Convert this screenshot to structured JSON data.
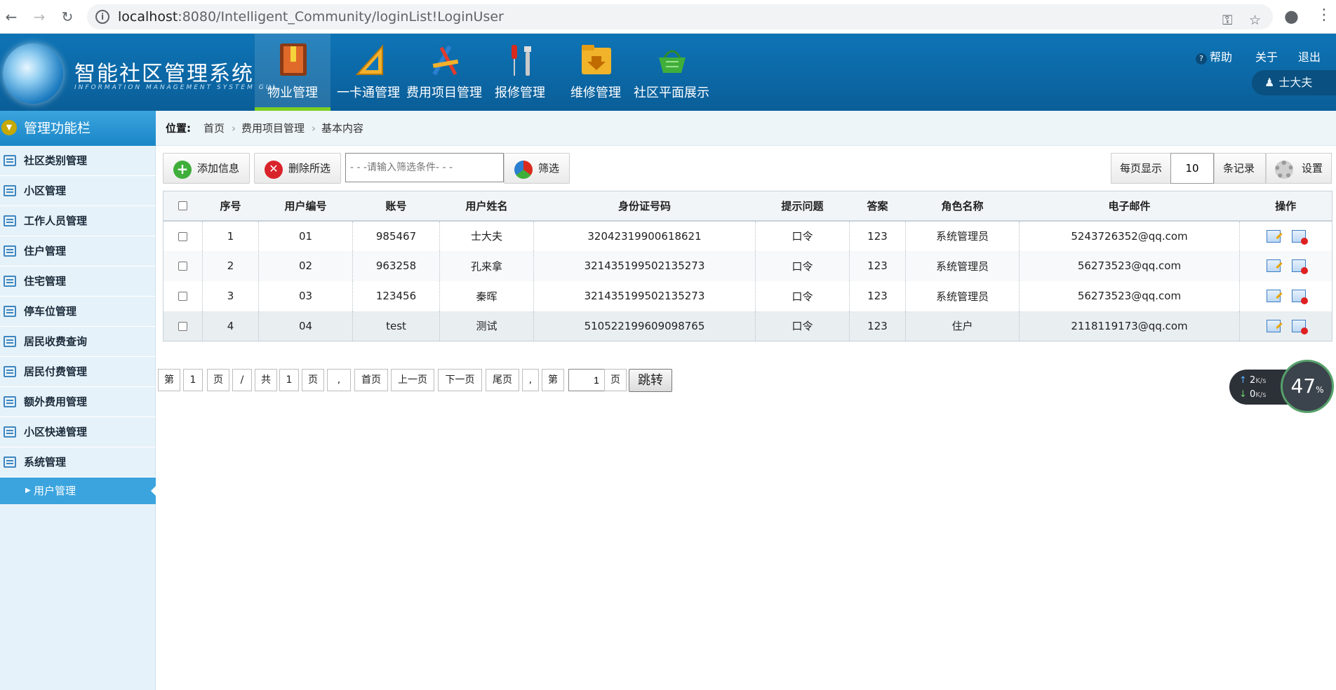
{
  "browser": {
    "url_host": "localhost",
    "url_path": ":8080/Intelligent_Community/loginList!LoginUser"
  },
  "header": {
    "title": "智能社区管理系统",
    "subtitle": "INFORMATION MANAGEMENT SYSTEM GUI",
    "nav": [
      {
        "label": "物业管理",
        "active": true
      },
      {
        "label": "一卡通管理"
      },
      {
        "label": "费用项目管理"
      },
      {
        "label": "报修管理"
      },
      {
        "label": "维修管理"
      },
      {
        "label": "社区平面展示"
      }
    ],
    "links": {
      "help": "帮助",
      "about": "关于",
      "logout": "退出"
    },
    "user": "士大夫"
  },
  "sidebar": {
    "title": "管理功能栏",
    "items": [
      {
        "label": "社区类别管理"
      },
      {
        "label": "小区管理"
      },
      {
        "label": "工作人员管理"
      },
      {
        "label": "住户管理"
      },
      {
        "label": "住宅管理"
      },
      {
        "label": "停车位管理"
      },
      {
        "label": "居民收费查询"
      },
      {
        "label": "居民付费管理"
      },
      {
        "label": "额外费用管理"
      },
      {
        "label": "小区快递管理"
      },
      {
        "label": "系统管理"
      }
    ],
    "sub_active": "用户管理"
  },
  "breadcrumb": {
    "lead": "位置:",
    "items": [
      "首页",
      "费用项目管理",
      "基本内容"
    ]
  },
  "toolbar": {
    "add": "添加信息",
    "delete": "删除所选",
    "filter_placeholder": "- - -请输入筛选条件- - -",
    "filter": "筛选",
    "per_page_label": "每页显示",
    "per_page_value": "10",
    "records_label": "条记录",
    "settings": "设置"
  },
  "table": {
    "headers": [
      "序号",
      "用户编号",
      "账号",
      "用户姓名",
      "身份证号码",
      "提示问题",
      "答案",
      "角色名称",
      "电子邮件",
      "操作"
    ],
    "rows": [
      [
        "1",
        "01",
        "985467",
        "士大夫",
        "32042319900618621",
        "口令",
        "123",
        "系统管理员",
        "5243726352@qq.com"
      ],
      [
        "2",
        "02",
        "963258",
        "孔来拿",
        "321435199502135273",
        "口令",
        "123",
        "系统管理员",
        "56273523@qq.com"
      ],
      [
        "3",
        "03",
        "123456",
        "秦晖",
        "321435199502135273",
        "口令",
        "123",
        "系统管理员",
        "56273523@qq.com"
      ],
      [
        "4",
        "04",
        "test",
        "测试",
        "510522199609098765",
        "口令",
        "123",
        "住户",
        "2118119173@qq.com"
      ]
    ]
  },
  "pagination": {
    "di": "第",
    "current": "1",
    "ye": "页",
    "slash": "/",
    "gong": "共",
    "total": "1",
    "ye2": "页",
    "comma": ",",
    "first": "首页",
    "prev": "上一页",
    "next": "下一页",
    "last": "尾页",
    "comma2": ",",
    "di2": "第",
    "input_value": "1",
    "ye3": "页",
    "go": "跳转"
  },
  "net_widget": {
    "up": "2",
    "up_unit": "K/s",
    "down": "0",
    "down_unit": "K/s",
    "percent": "47",
    "percent_unit": "%"
  },
  "colors": {
    "header_blue": "#0e74b6",
    "sidebar_accent": "#3ba4de",
    "active_underline": "#7cd020"
  }
}
